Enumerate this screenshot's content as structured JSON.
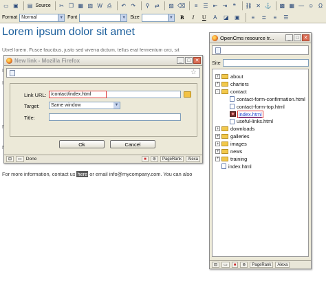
{
  "toolbar": {
    "source_label": "Source",
    "format_label": "Format",
    "format_value": "Normal",
    "font_label": "Font",
    "font_value": "",
    "size_label": "Size",
    "size_value": "",
    "bold": "B",
    "italic": "I",
    "underline": "U"
  },
  "document": {
    "title": "Lorem ipsum dolor sit amet",
    "para_lines": [
      "Utvel lorem. Fusce faucibus, justo sed viverra dictum, tellus erat fermentum orci, sit",
      "I",
      "I",
      "N",
      "N"
    ],
    "footer_before": "For more information, contact us ",
    "footer_highlight": "here",
    "footer_after": " or email info@mycompany.com. You can also"
  },
  "link_dialog": {
    "title": "New link - Mozilla Firefox",
    "link_url_label": "Link URL:",
    "link_url_value": "/contact/index.html",
    "target_label": "Target:",
    "target_value": "Same window",
    "title_label": "Title:",
    "title_value": "",
    "ok_label": "Ok",
    "cancel_label": "Cancel",
    "status_text": "Done",
    "pagerank_label": "PageRank",
    "alexa_label": "Alexa"
  },
  "resource_tree": {
    "title": "OpenCms resource tr...",
    "site_label": "Site",
    "nodes": [
      {
        "label": "about",
        "type": "folder",
        "expander": "+"
      },
      {
        "label": "charters",
        "type": "folder",
        "expander": "+"
      },
      {
        "label": "contact",
        "type": "folder",
        "expander": "-"
      },
      {
        "label": "contact-form-confirmation.html",
        "type": "file",
        "expander": ""
      },
      {
        "label": "contact-form-top.html",
        "type": "file",
        "expander": ""
      },
      {
        "label": "index.html",
        "type": "current",
        "expander": ""
      },
      {
        "label": "useful-links.html",
        "type": "file",
        "expander": ""
      },
      {
        "label": "downloads",
        "type": "folder",
        "expander": "+"
      },
      {
        "label": "galleries",
        "type": "folder",
        "expander": "+"
      },
      {
        "label": "images",
        "type": "folder",
        "expander": "+"
      },
      {
        "label": "news",
        "type": "folder",
        "expander": "+"
      },
      {
        "label": "training",
        "type": "folder",
        "expander": "+"
      },
      {
        "label": "index.html",
        "type": "file",
        "expander": ""
      }
    ],
    "pagerank_label": "PageRank",
    "alexa_label": "Alexa"
  },
  "colors": {
    "title_blue": "#1c5f9c",
    "highlight_red": "#e23b3b",
    "link_blue": "#1a3fd0"
  }
}
